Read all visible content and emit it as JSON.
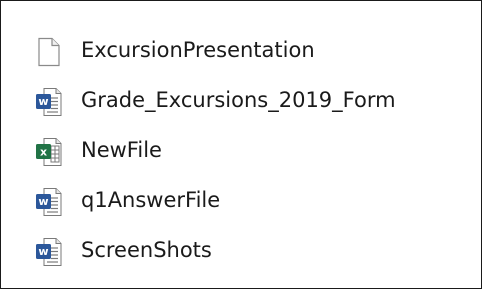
{
  "files": [
    {
      "name": "ExcursionPresentation",
      "icon": "blank-document-icon",
      "type": "generic"
    },
    {
      "name": "Grade_Excursions_2019_Form",
      "icon": "word-document-icon",
      "type": "word"
    },
    {
      "name": "NewFile",
      "icon": "excel-spreadsheet-icon",
      "type": "excel"
    },
    {
      "name": "q1AnswerFile",
      "icon": "word-document-icon",
      "type": "word"
    },
    {
      "name": "ScreenShots",
      "icon": "word-document-icon",
      "type": "word"
    }
  ],
  "colors": {
    "word": "#2b579a",
    "excel": "#217346",
    "text": "#1a1a1a",
    "border": "#1a1a1a"
  }
}
